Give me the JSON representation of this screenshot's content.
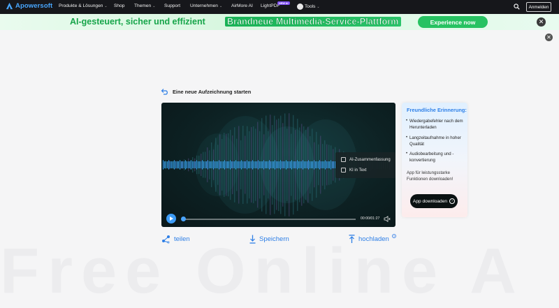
{
  "nav": {
    "logo": "Apowersoft",
    "items": [
      {
        "label": "Produkte & Lösungen",
        "caret": true
      },
      {
        "label": "Shop",
        "caret": false
      },
      {
        "label": "Themen",
        "caret": true
      },
      {
        "label": "Support",
        "caret": false
      },
      {
        "label": "Unternehmen",
        "caret": true
      },
      {
        "label": "AirMore AI",
        "caret": false
      },
      {
        "label": "LightPDF",
        "caret": false
      },
      {
        "label": "Tools",
        "caret": true
      }
    ],
    "lightpdf_badge": "NEW AI",
    "login": "Anmelden"
  },
  "banner": {
    "left_text": "AI-gesteuert, sicher und effizient",
    "mid_text": "Brandneue Multimedia-Service-Plattform",
    "button": "Experience now",
    "accent": "#27c262"
  },
  "watermark": "Free Online A",
  "new_recording": "Eine neue Aufzeichnung starten",
  "player": {
    "menu": [
      "AI-Zusammenfassung",
      "KI in Text"
    ],
    "time": "00:00/01:27",
    "progress": 0.0
  },
  "actions": [
    "teilen",
    "Speichern",
    "hochladen"
  ],
  "reminder": {
    "title": "Freundliche Erinnerung:",
    "items": [
      "Wiedergabefehler nach dem Herunterladen",
      "Langzeitaufnahme in hoher Qualität",
      "Audiobearbeitung und -konvertierung"
    ],
    "text": "App für leistungsstarke Funktionen downloaden!",
    "button": "App downloaden"
  },
  "colors": {
    "accent": "#2e7fe6",
    "nav_bg": "#16171b",
    "player_bg": "#0d2123"
  }
}
